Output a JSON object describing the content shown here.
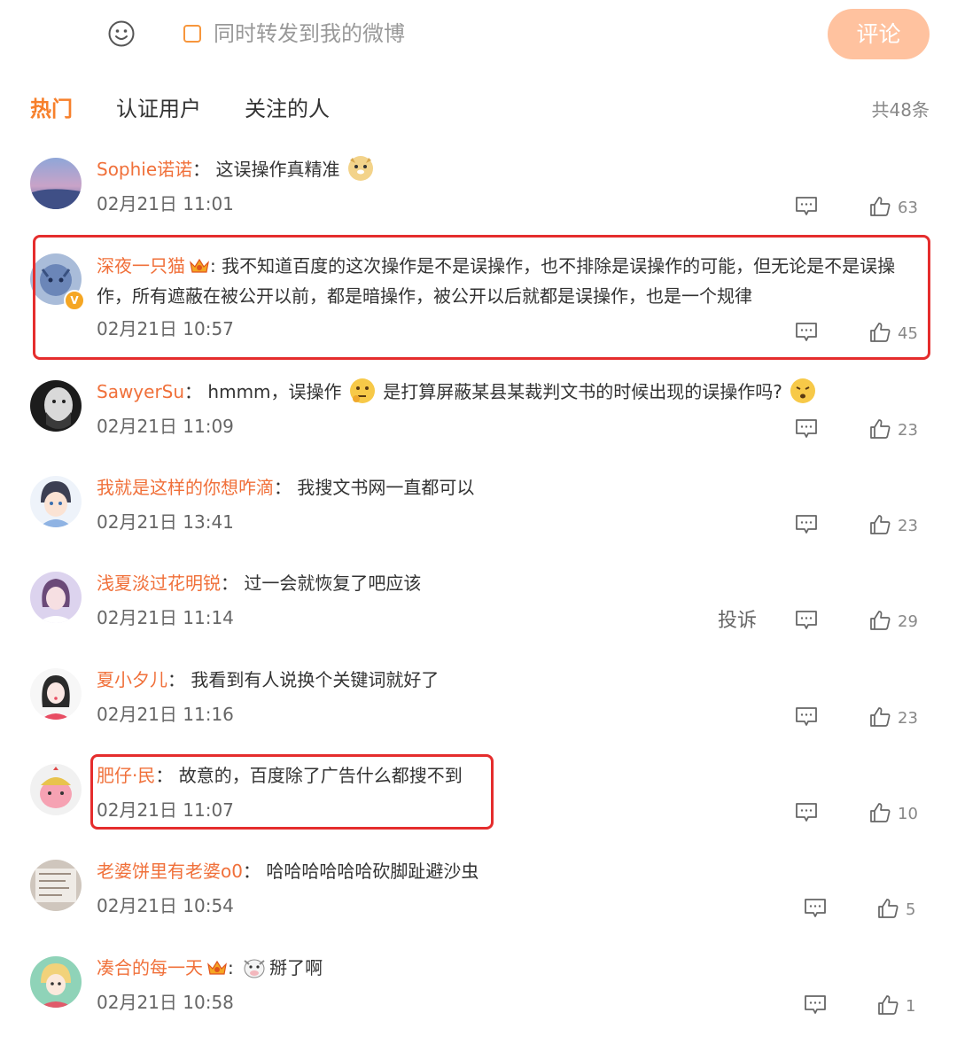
{
  "composer": {
    "repost_label": "同时转发到我的微博",
    "submit_label": "评论"
  },
  "tabs": [
    {
      "label": "热门",
      "active": true
    },
    {
      "label": "认证用户",
      "active": false
    },
    {
      "label": "关注的人",
      "active": false
    }
  ],
  "total_label": "共48条",
  "comments": [
    {
      "user": "Sophie诺诺",
      "sep": "：",
      "text_a": " 这误操作真精准",
      "emoji_a": "doge",
      "text_b": "",
      "emoji_b": "",
      "time": "02月21日 11:01",
      "likes": "63",
      "has_crown": false,
      "verified": false,
      "report": ""
    },
    {
      "user": "深夜一只猫",
      "sep": ":",
      "text_a": " 我不知道百度的这次操作是不是误操作，也不排除是误操作的可能，但无论是不是误操作，所有遮蔽在被公开以前，都是暗操作，被公开以后就都是误操作，也是一个规律",
      "emoji_a": "",
      "text_b": "",
      "emoji_b": "",
      "time": "02月21日 10:57",
      "likes": "45",
      "has_crown": true,
      "verified": true,
      "report": ""
    },
    {
      "user": "SawyerSu",
      "sep": "：",
      "text_a": " hmmm，误操作",
      "emoji_a": "thinking",
      "text_b": " 是打算屏蔽某县某裁判文书的时候出现的误操作吗?",
      "emoji_b": "confused",
      "time": "02月21日 11:09",
      "likes": "23",
      "has_crown": false,
      "verified": false,
      "report": ""
    },
    {
      "user": "我就是这样的你想咋滴",
      "sep": "：",
      "text_a": " 我搜文书网一直都可以",
      "emoji_a": "",
      "text_b": "",
      "emoji_b": "",
      "time": "02月21日 13:41",
      "likes": "23",
      "has_crown": false,
      "verified": false,
      "report": ""
    },
    {
      "user": "浅夏淡过花明锐",
      "sep": "：",
      "text_a": " 过一会就恢复了吧应该",
      "emoji_a": "",
      "text_b": "",
      "emoji_b": "",
      "time": "02月21日 11:14",
      "likes": "29",
      "has_crown": false,
      "verified": false,
      "report": "投诉"
    },
    {
      "user": "夏小夕儿",
      "sep": "：",
      "text_a": " 我看到有人说换个关键词就好了",
      "emoji_a": "",
      "text_b": "",
      "emoji_b": "",
      "time": "02月21日 11:16",
      "likes": "23",
      "has_crown": false,
      "verified": false,
      "report": ""
    },
    {
      "user": "肥仔·民",
      "sep": "：",
      "text_a": " 故意的，百度除了广告什么都搜不到",
      "emoji_a": "",
      "text_b": "",
      "emoji_b": "",
      "time": "02月21日 11:07",
      "likes": "10",
      "has_crown": false,
      "verified": false,
      "report": ""
    },
    {
      "user": "老婆饼里有老婆o0",
      "sep": "：",
      "text_a": " 哈哈哈哈哈哈砍脚趾避沙虫",
      "emoji_a": "",
      "text_b": "",
      "emoji_b": "",
      "time": "02月21日 10:54",
      "likes": "5",
      "has_crown": false,
      "verified": false,
      "report": ""
    },
    {
      "user": "凑合的每一天",
      "sep": ":",
      "text_a": " ",
      "emoji_a": "cow",
      "text_b": "掰了啊",
      "emoji_b": "",
      "time": "02月21日 10:58",
      "likes": "1",
      "has_crown": true,
      "verified": false,
      "report": ""
    }
  ],
  "colors": {
    "accent": "#f7802b",
    "username": "#f0703a",
    "highlight_box": "#e52d2d",
    "submit_bg": "#ffc29f"
  }
}
